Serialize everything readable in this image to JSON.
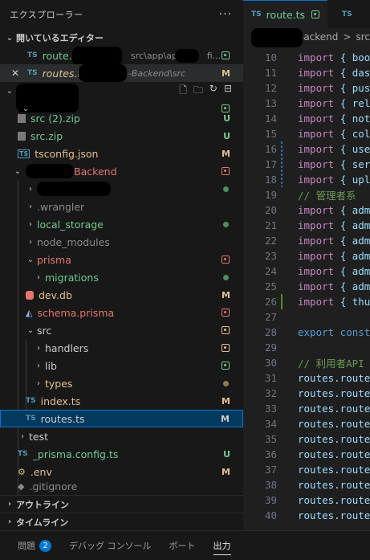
{
  "sidebar": {
    "title": "エクスプローラー",
    "more": "···",
    "open_editors": {
      "header": "開いているエディター",
      "items": [
        {
          "name": "route.ts",
          "path": "src\\app\\api\\",
          "path_tail": "fi...",
          "status": "g"
        },
        {
          "name": "routes.ts",
          "path": "-Backend\\src",
          "status": "M"
        }
      ]
    },
    "tree": [
      {
        "label": "src (2).zip",
        "status": "U"
      },
      {
        "label": "src.zip",
        "status": "U"
      },
      {
        "label": "tsconfig.json",
        "status": "M"
      },
      {
        "label": "-Backend"
      },
      {
        "label": ""
      },
      {
        "label": ".wrangler"
      },
      {
        "label": "local_storage"
      },
      {
        "label": "node_modules"
      },
      {
        "label": "prisma"
      },
      {
        "label": "migrations"
      },
      {
        "label": "dev.db",
        "status": "M"
      },
      {
        "label": "schema.prisma"
      },
      {
        "label": "src"
      },
      {
        "label": "handlers"
      },
      {
        "label": "lib"
      },
      {
        "label": "types"
      },
      {
        "label": "index.ts",
        "status": "M"
      },
      {
        "label": "routes.ts",
        "status": "M"
      },
      {
        "label": "test"
      },
      {
        "label": "_prisma.config.ts",
        "status": "U"
      },
      {
        "label": ".env",
        "status": "M"
      },
      {
        "label": ".gitignore"
      }
    ],
    "outline": "アウトライン",
    "timeline": "タイムライン"
  },
  "editor": {
    "tabs": [
      {
        "label": "route.ts"
      },
      {
        "label": "TS"
      }
    ],
    "breadcrumb": {
      "part1": "-Backend",
      "sep": ">",
      "part2": "src"
    },
    "lines": [
      {
        "n": "10",
        "kw": "import",
        "rest": "{ boo"
      },
      {
        "n": "11",
        "kw": "import",
        "rest": "{ das"
      },
      {
        "n": "12",
        "kw": "import",
        "rest": "{ pus"
      },
      {
        "n": "13",
        "kw": "import",
        "rest": "{ rel"
      },
      {
        "n": "14",
        "kw": "import",
        "rest": "{ not"
      },
      {
        "n": "15",
        "kw": "import",
        "rest": "{ col"
      },
      {
        "n": "16",
        "kw": "import",
        "rest": "{ use"
      },
      {
        "n": "17",
        "kw": "import",
        "rest": "{ ser"
      },
      {
        "n": "18",
        "kw": "import",
        "rest": "{ upl"
      },
      {
        "n": "19",
        "comment": "// 管理者系"
      },
      {
        "n": "20",
        "kw": "import",
        "rest": "{ adm"
      },
      {
        "n": "21",
        "kw": "import",
        "rest": "{ adm"
      },
      {
        "n": "22",
        "kw": "import",
        "rest": "{ adm"
      },
      {
        "n": "23",
        "kw": "import",
        "rest": "{ adm"
      },
      {
        "n": "24",
        "kw": "import",
        "rest": "{ adm"
      },
      {
        "n": "25",
        "kw": "import",
        "rest": "{ adm"
      },
      {
        "n": "26",
        "kw": "import",
        "rest": "{ thu"
      },
      {
        "n": "27"
      },
      {
        "n": "28",
        "export": "export const"
      },
      {
        "n": "29"
      },
      {
        "n": "30",
        "comment": "// 利用者API"
      },
      {
        "n": "31",
        "route": "routes.route"
      },
      {
        "n": "32",
        "route": "routes.route"
      },
      {
        "n": "33",
        "route": "routes.route"
      },
      {
        "n": "34",
        "route": "routes.route"
      },
      {
        "n": "35",
        "route": "routes.route"
      },
      {
        "n": "36",
        "route": "routes.route"
      },
      {
        "n": "37",
        "route": "routes.route"
      },
      {
        "n": "38",
        "route": "routes.route"
      },
      {
        "n": "39",
        "route": "routes.route"
      },
      {
        "n": "40",
        "route": "routes.route"
      }
    ]
  },
  "panel": {
    "problems": "問題",
    "problems_count": "2",
    "debug_console": "デバッグ コンソール",
    "ports": "ポート",
    "output": "出力"
  },
  "icons": {
    "ts_label": "TS"
  }
}
